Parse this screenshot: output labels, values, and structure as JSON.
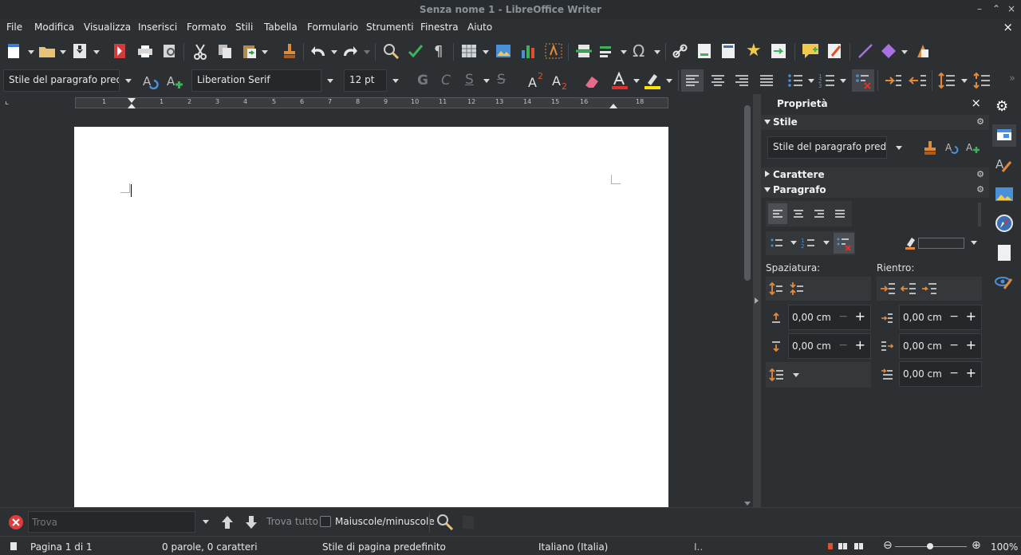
{
  "window": {
    "title": "Senza nome 1 - LibreOffice Writer"
  },
  "menu": [
    "File",
    "Modifica",
    "Visualizza",
    "Inserisci",
    "Formato",
    "Stili",
    "Tabella",
    "Formulario",
    "Strumenti",
    "Finestra",
    "Aiuto"
  ],
  "formatting": {
    "paragraph_style": "Stile del paragrafo predef",
    "font_name": "Liberation Serif",
    "font_size": "12 pt"
  },
  "ruler": {
    "ticks": [
      "1",
      "1",
      "2",
      "3",
      "4",
      "5",
      "6",
      "7",
      "8",
      "9",
      "10",
      "11",
      "12",
      "13",
      "14",
      "15",
      "16",
      "17",
      "18"
    ]
  },
  "sidebar": {
    "title": "Proprietà",
    "style_panel": {
      "title": "Stile",
      "value": "Stile del paragrafo predefi"
    },
    "char_panel": {
      "title": "Carattere"
    },
    "para_panel": {
      "title": "Paragrafo",
      "spacing_label": "Spaziatura:",
      "indent_label": "Rientro:",
      "above_spacing": "0,00 cm",
      "below_spacing": "0,00 cm",
      "before_indent": "0,00 cm",
      "after_indent": "0,00 cm",
      "first_line_indent": "0,00 cm"
    }
  },
  "findbar": {
    "placeholder": "Trova",
    "find_all": "Trova tutto",
    "match_case": "Maiuscole/minuscole"
  },
  "status": {
    "page": "Pagina 1 di 1",
    "words": "0 parole, 0 caratteri",
    "page_style": "Stile di pagina predefinito",
    "language": "Italiano (Italia)",
    "zoom": "100%"
  },
  "colors": {
    "accent_blue": "#4a90d9",
    "font_color": "#e0312b",
    "highlight": "#ffe600",
    "page": "#ffffff",
    "ui_bg": "#2d3033"
  }
}
